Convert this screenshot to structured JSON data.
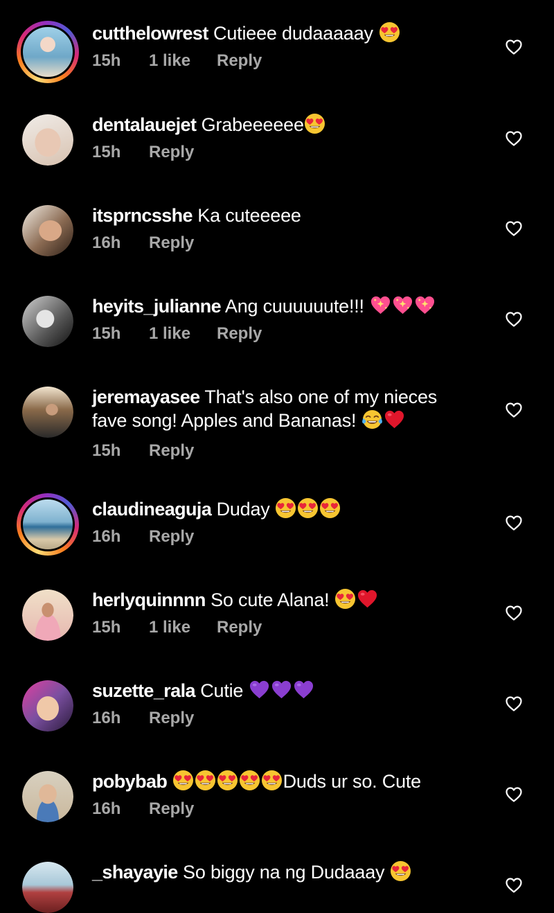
{
  "comments": [
    {
      "username": "cutthelowrest",
      "text": "Cutieee dudaaaaay",
      "emojis": [
        "heart-eyes"
      ],
      "time": "15h",
      "likes": "1 like",
      "reply": "Reply",
      "story": true,
      "avatar_color": "#6fa8c8"
    },
    {
      "username": "dentalauejet",
      "text": "Grabeeeeee",
      "emojis": [
        "heart-eyes"
      ],
      "time": "15h",
      "likes": "",
      "reply": "Reply",
      "story": false,
      "avatar_color": "#d8c2b0"
    },
    {
      "username": "itsprncsshe",
      "text": "Ka cuteeeee",
      "emojis": [],
      "time": "16h",
      "likes": "",
      "reply": "Reply",
      "story": false,
      "avatar_color": "#8a6a52"
    },
    {
      "username": "heyits_julianne",
      "text": "Ang cuuuuuute!!!",
      "emojis": [
        "sparkling-heart",
        "sparkling-heart",
        "sparkling-heart"
      ],
      "time": "15h",
      "likes": "1 like",
      "reply": "Reply",
      "story": false,
      "avatar_color": "#b9b9b9"
    },
    {
      "username": "jeremayasee",
      "text": "That's also one of my nieces fave song! Apples and Bananas!",
      "emojis": [
        "tears-of-joy",
        "red-heart"
      ],
      "time": "15h",
      "likes": "",
      "reply": "Reply",
      "story": false,
      "avatar_color": "#5a4a3a"
    },
    {
      "username": "claudineaguja",
      "text": "Duday",
      "emojis": [
        "heart-eyes",
        "heart-eyes",
        "heart-eyes"
      ],
      "time": "16h",
      "likes": "",
      "reply": "Reply",
      "story": true,
      "avatar_color": "#7fb2cf"
    },
    {
      "username": "herlyquinnnn",
      "text": "So cute Alana!",
      "emojis": [
        "heart-eyes",
        "red-heart"
      ],
      "time": "15h",
      "likes": "1 like",
      "reply": "Reply",
      "story": false,
      "avatar_color": "#e6b7b0"
    },
    {
      "username": "suzette_rala",
      "text": "Cutie",
      "emojis": [
        "purple-heart",
        "purple-heart",
        "purple-heart"
      ],
      "time": "16h",
      "likes": "",
      "reply": "Reply",
      "story": false,
      "avatar_color": "#7a4fa0"
    },
    {
      "username": "pobybab",
      "text": "Duds ur so. Cute",
      "emojis_before": [
        "heart-eyes",
        "heart-eyes",
        "heart-eyes",
        "heart-eyes",
        "heart-eyes"
      ],
      "emojis": [],
      "time": "16h",
      "likes": "",
      "reply": "Reply",
      "story": false,
      "avatar_color": "#c9b89c"
    },
    {
      "username": "_shayayie",
      "text": "So biggy na ng Dudaaay",
      "emojis": [
        "heart-eyes"
      ],
      "time": "",
      "likes": "",
      "reply": "",
      "story": false,
      "avatar_color": "#b04040"
    }
  ],
  "colors": {
    "background": "#000000",
    "text": "#ffffff",
    "meta": "#a8a8a8"
  }
}
